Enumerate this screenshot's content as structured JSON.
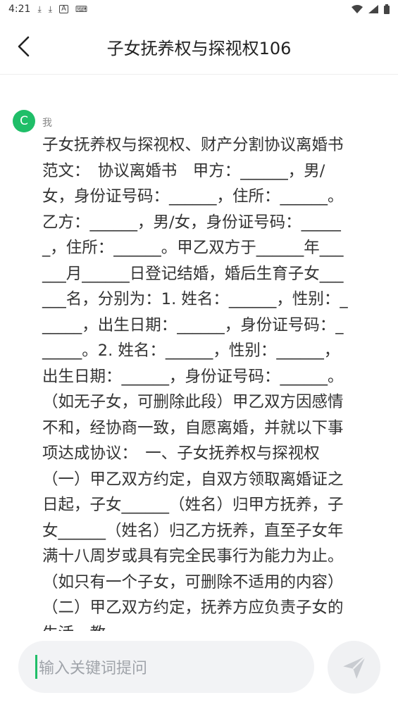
{
  "status_bar": {
    "time": "4:21",
    "icons": [
      "download-icon",
      "download-icon",
      "a-icon",
      "keyboard-icon",
      "wifi-icon",
      "signal-icon",
      "battery-icon"
    ]
  },
  "header": {
    "title": "子女抚养权与探视权106",
    "back_icon": "chevron-left-icon"
  },
  "message": {
    "avatar_letter": "C",
    "sender": "我",
    "text": "子女抚养权与探视权、财产分割协议离婚书范文：　协议离婚书　甲方：______，男/女，身份证号码：______，住所：______。乙方：______，男/女，身份证号码：______，住所：______。甲乙双方于______年______月______日登记结婚，婚后生育子女______名，分别为：1. 姓名：______，性别：______，出生日期：______，身份证号码：______。2. 姓名：______，性别：______，出生日期：______，身份证号码：______。（如无子女，可删除此段）甲乙双方因感情不和，经协商一致，自愿离婚，并就以下事项达成协议：　一、子女抚养权与探视权（一）甲乙双方约定，自双方领取离婚证之日起，子女______（姓名）归甲方抚养，子女______（姓名）归乙方抚养，直至子女年满十八周岁或具有完全民事行为能力为止。（如只有一个子女，可删除不适用的内容）（二）甲乙双方约定，抚养方应负责子女的生活、教"
  },
  "input": {
    "placeholder": "输入关键词提问",
    "send_icon": "send-icon"
  },
  "colors": {
    "accent": "#1fbe68",
    "input_bg": "#f2f3f5",
    "placeholder": "#a0a4aa"
  }
}
